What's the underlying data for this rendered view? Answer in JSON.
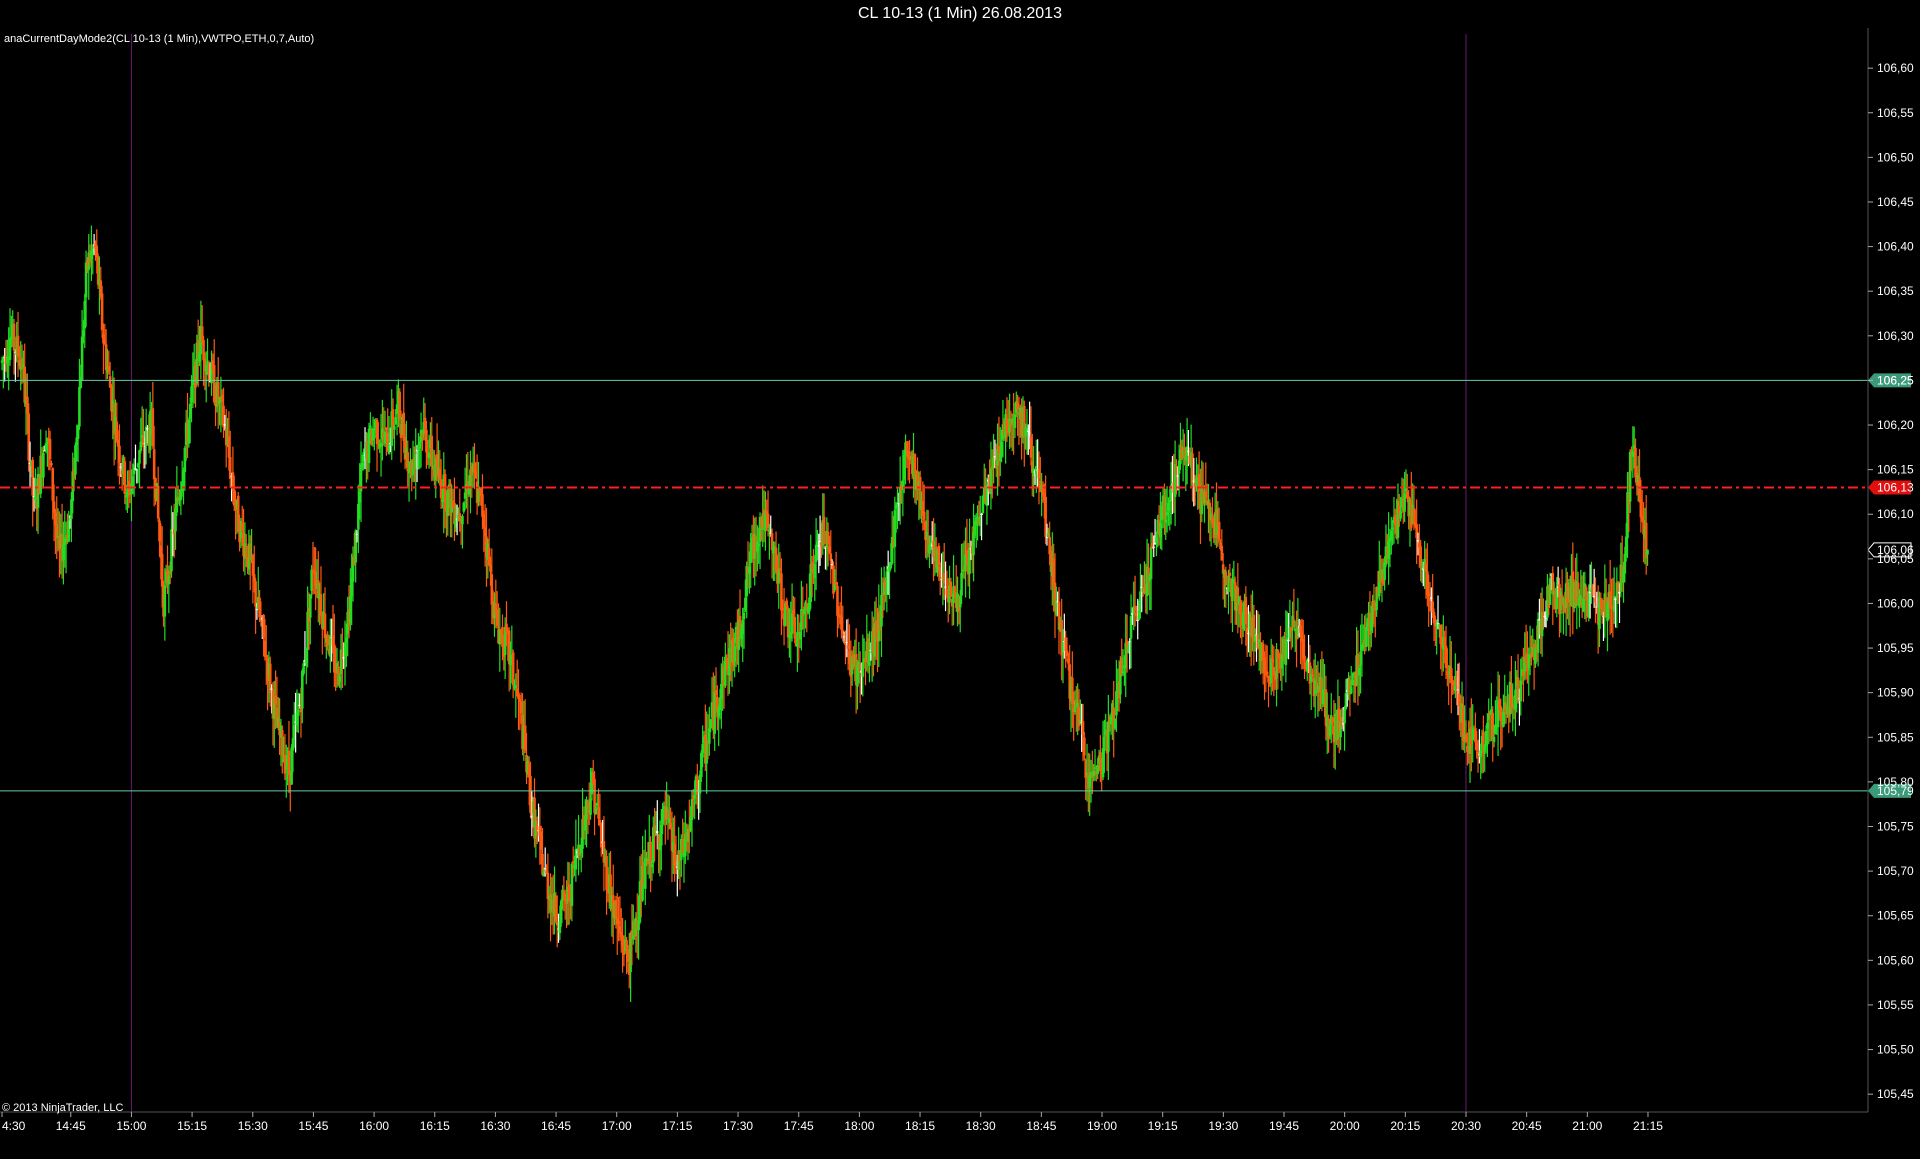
{
  "window": {
    "title": "CL 10-13 (1 Min)  26.08.2013"
  },
  "chart_data": {
    "type": "candlestick",
    "title": "CL 10-13 (1 Min)  26.08.2013",
    "indicator_label": "anaCurrentDayMode2(CL 10-13 (1 Min),VWTPO,ETH,0,7,Auto)",
    "copyright": "© 2013 NinjaTrader, LLC",
    "ylim": [
      105.43,
      106.645
    ],
    "y_ticks": [
      "106,60",
      "106,55",
      "106,50",
      "106,45",
      "106,40",
      "106,35",
      "106,30",
      "106,25",
      "106,20",
      "106,15",
      "106,10",
      "106,05",
      "106,00",
      "105,95",
      "105,90",
      "105,85",
      "105,80",
      "105,75",
      "105,70",
      "105,65",
      "105,60",
      "105,55",
      "105,50",
      "105,45"
    ],
    "y_tick_values": [
      106.6,
      106.55,
      106.5,
      106.45,
      106.4,
      106.35,
      106.3,
      106.25,
      106.2,
      106.15,
      106.1,
      106.05,
      106.0,
      105.95,
      105.9,
      105.85,
      105.8,
      105.75,
      105.7,
      105.65,
      105.6,
      105.55,
      105.5,
      105.45
    ],
    "x_ticks": [
      "4:30",
      "14:45",
      "15:00",
      "15:15",
      "15:30",
      "15:45",
      "16:00",
      "16:15",
      "16:30",
      "16:45",
      "17:00",
      "17:15",
      "17:30",
      "17:45",
      "18:00",
      "18:15",
      "18:30",
      "18:45",
      "19:00",
      "19:15",
      "19:30",
      "19:45",
      "20:00",
      "20:15",
      "20:30",
      "20:45",
      "21:00",
      "21:15"
    ],
    "x_tick_minutes": [
      868,
      885,
      900,
      915,
      930,
      945,
      960,
      975,
      990,
      1005,
      1020,
      1035,
      1050,
      1065,
      1080,
      1095,
      1110,
      1125,
      1140,
      1155,
      1170,
      1185,
      1200,
      1215,
      1230,
      1245,
      1260,
      1275
    ],
    "x_range_minutes": [
      867.5,
      1275.5
    ],
    "reference_lines": [
      {
        "name": "value-area-high",
        "value": 106.25,
        "label": "106,25",
        "color": "#66ccaa",
        "style": "solid"
      },
      {
        "name": "value-area-low",
        "value": 105.79,
        "label": "105,79",
        "color": "#66ccaa",
        "style": "solid"
      },
      {
        "name": "mode",
        "value": 106.13,
        "label": "106,13",
        "color": "#ff2020",
        "style": "dash-dot"
      }
    ],
    "last_price": {
      "value": 106.06,
      "label": "106,06"
    },
    "session_lines_minutes": [
      900,
      1230
    ],
    "colors": {
      "up": "#22dd22",
      "down": "#ff5a10",
      "doji": "#ffffff",
      "grid": "#555555",
      "session": "#6a1a6a"
    },
    "series": [
      {
        "name": "close_path",
        "points": [
          [
            868,
            106.27
          ],
          [
            870,
            106.3
          ],
          [
            873,
            106.27
          ],
          [
            876,
            106.1
          ],
          [
            879,
            106.2
          ],
          [
            882,
            106.05
          ],
          [
            885,
            106.1
          ],
          [
            887,
            106.23
          ],
          [
            889,
            106.38
          ],
          [
            891,
            106.4
          ],
          [
            893,
            106.3
          ],
          [
            896,
            106.2
          ],
          [
            899,
            106.12
          ],
          [
            902,
            106.17
          ],
          [
            905,
            106.2
          ],
          [
            908,
            106.0
          ],
          [
            911,
            106.1
          ],
          [
            914,
            106.2
          ],
          [
            917,
            106.3
          ],
          [
            920,
            106.25
          ],
          [
            923,
            106.2
          ],
          [
            926,
            106.1
          ],
          [
            929,
            106.05
          ],
          [
            931,
            106.0
          ],
          [
            933,
            105.95
          ],
          [
            936,
            105.86
          ],
          [
            939,
            105.81
          ],
          [
            942,
            105.9
          ],
          [
            945,
            106.05
          ],
          [
            948,
            105.97
          ],
          [
            951,
            105.92
          ],
          [
            954,
            106.0
          ],
          [
            957,
            106.15
          ],
          [
            960,
            106.2
          ],
          [
            963,
            106.18
          ],
          [
            966,
            106.22
          ],
          [
            969,
            106.15
          ],
          [
            972,
            106.2
          ],
          [
            975,
            106.15
          ],
          [
            978,
            106.12
          ],
          [
            981,
            106.1
          ],
          [
            984,
            106.15
          ],
          [
            987,
            106.1
          ],
          [
            990,
            105.98
          ],
          [
            993,
            105.95
          ],
          [
            996,
            105.88
          ],
          [
            999,
            105.77
          ],
          [
            1002,
            105.7
          ],
          [
            1005,
            105.65
          ],
          [
            1008,
            105.67
          ],
          [
            1011,
            105.74
          ],
          [
            1014,
            105.8
          ],
          [
            1017,
            105.71
          ],
          [
            1020,
            105.64
          ],
          [
            1023,
            105.6
          ],
          [
            1026,
            105.68
          ],
          [
            1029,
            105.73
          ],
          [
            1032,
            105.76
          ],
          [
            1035,
            105.7
          ],
          [
            1038,
            105.75
          ],
          [
            1041,
            105.82
          ],
          [
            1044,
            105.88
          ],
          [
            1047,
            105.93
          ],
          [
            1050,
            105.96
          ],
          [
            1053,
            106.05
          ],
          [
            1056,
            106.1
          ],
          [
            1059,
            106.05
          ],
          [
            1062,
            105.98
          ],
          [
            1065,
            105.96
          ],
          [
            1068,
            106.03
          ],
          [
            1071,
            106.08
          ],
          [
            1074,
            106.02
          ],
          [
            1077,
            105.94
          ],
          [
            1080,
            105.92
          ],
          [
            1083,
            105.95
          ],
          [
            1086,
            106.0
          ],
          [
            1089,
            106.1
          ],
          [
            1092,
            106.18
          ],
          [
            1095,
            106.12
          ],
          [
            1098,
            106.05
          ],
          [
            1101,
            106.03
          ],
          [
            1104,
            106.0
          ],
          [
            1107,
            106.05
          ],
          [
            1110,
            106.1
          ],
          [
            1113,
            106.15
          ],
          [
            1116,
            106.2
          ],
          [
            1119,
            106.22
          ],
          [
            1122,
            106.18
          ],
          [
            1125,
            106.12
          ],
          [
            1128,
            106.02
          ],
          [
            1131,
            105.93
          ],
          [
            1134,
            105.87
          ],
          [
            1137,
            105.8
          ],
          [
            1140,
            105.83
          ],
          [
            1143,
            105.88
          ],
          [
            1146,
            105.95
          ],
          [
            1149,
            106.0
          ],
          [
            1152,
            106.05
          ],
          [
            1155,
            106.1
          ],
          [
            1158,
            106.14
          ],
          [
            1161,
            106.18
          ],
          [
            1164,
            106.12
          ],
          [
            1167,
            106.1
          ],
          [
            1170,
            106.05
          ],
          [
            1173,
            106.0
          ],
          [
            1176,
            105.98
          ],
          [
            1179,
            105.95
          ],
          [
            1182,
            105.92
          ],
          [
            1185,
            105.95
          ],
          [
            1188,
            105.98
          ],
          [
            1191,
            105.93
          ],
          [
            1194,
            105.9
          ],
          [
            1197,
            105.85
          ],
          [
            1200,
            105.88
          ],
          [
            1203,
            105.93
          ],
          [
            1206,
            105.98
          ],
          [
            1209,
            106.03
          ],
          [
            1212,
            106.08
          ],
          [
            1215,
            106.12
          ],
          [
            1218,
            106.08
          ],
          [
            1221,
            106.0
          ],
          [
            1224,
            105.95
          ],
          [
            1227,
            105.92
          ],
          [
            1230,
            105.85
          ],
          [
            1233,
            105.84
          ],
          [
            1236,
            105.86
          ],
          [
            1239,
            105.88
          ],
          [
            1242,
            105.9
          ],
          [
            1245,
            105.93
          ],
          [
            1248,
            105.97
          ],
          [
            1251,
            106.02
          ],
          [
            1254,
            106.0
          ],
          [
            1257,
            106.02
          ],
          [
            1260,
            106.0
          ],
          [
            1263,
            105.99
          ],
          [
            1266,
            106.0
          ],
          [
            1269,
            106.04
          ],
          [
            1271,
            106.18
          ],
          [
            1273,
            106.12
          ],
          [
            1275,
            106.05
          ]
        ]
      }
    ]
  }
}
